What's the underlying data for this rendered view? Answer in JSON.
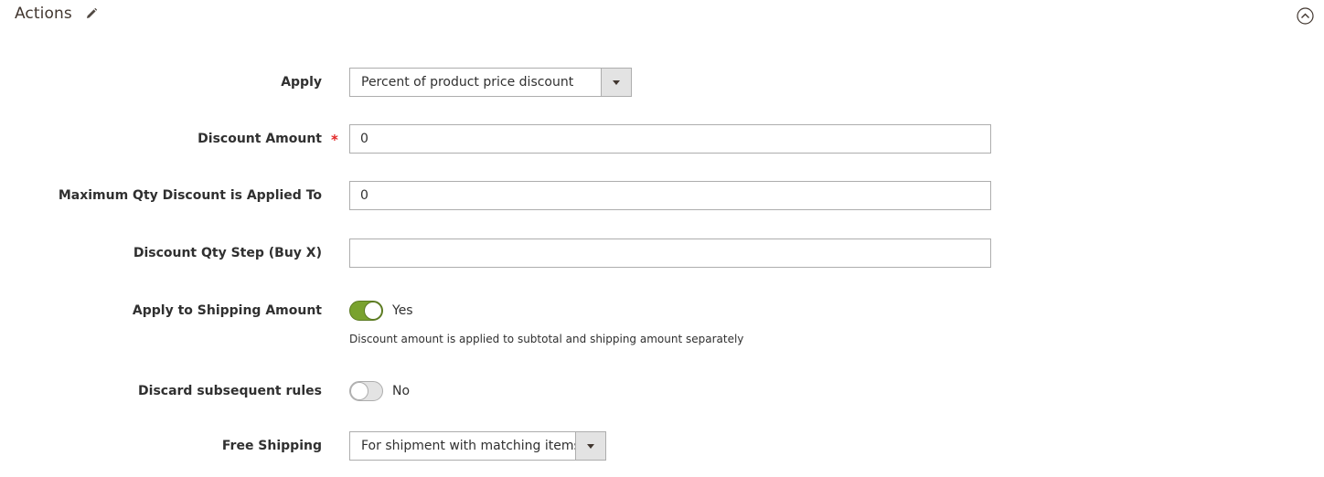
{
  "section": {
    "title": "Actions"
  },
  "fields": {
    "apply": {
      "label": "Apply",
      "value": "Percent of product price discount"
    },
    "discount_amount": {
      "label": "Discount Amount",
      "required_mark": "*",
      "value": "0"
    },
    "max_qty": {
      "label": "Maximum Qty Discount is Applied To",
      "value": "0"
    },
    "qty_step": {
      "label": "Discount Qty Step (Buy X)",
      "value": ""
    },
    "apply_shipping": {
      "label": "Apply to Shipping Amount",
      "state": "Yes",
      "note": "Discount amount is applied to subtotal and shipping amount separately"
    },
    "discard_rules": {
      "label": "Discard subsequent rules",
      "state": "No"
    },
    "free_shipping": {
      "label": "Free Shipping",
      "value": "For shipment with matching items"
    }
  },
  "colors": {
    "toggle_on": "#79a22e",
    "required": "#e22626"
  },
  "icons": {
    "edit": "pencil-icon",
    "collapse": "chevron-up-circle-icon",
    "dropdown": "caret-down-icon"
  }
}
